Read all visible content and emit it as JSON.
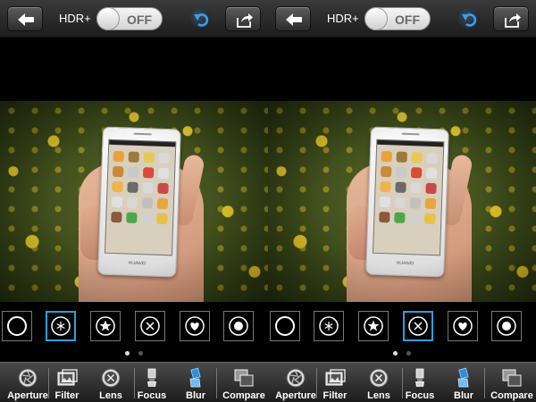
{
  "panels": [
    {
      "id": "left",
      "topbar": {
        "hdr_label": "HDR+",
        "hdr_toggle": "OFF"
      },
      "selected_shape_index": 1,
      "pager": {
        "page_count": 2,
        "active_page": 0
      },
      "toolbar": [
        "Aperture",
        "Filter",
        "Lens",
        "Focus",
        "Blur",
        "Compare"
      ]
    },
    {
      "id": "right",
      "topbar": {
        "hdr_label": "HDR+",
        "hdr_toggle": "OFF"
      },
      "selected_shape_index": 3,
      "pager": {
        "page_count": 2,
        "active_page": 0
      },
      "toolbar": [
        "Aperture",
        "Filter",
        "Lens",
        "Focus",
        "Blur",
        "Compare"
      ]
    }
  ],
  "phone_brand": "HUAWEI",
  "shapes": [
    "circle-icon",
    "asterisk-icon",
    "star-icon",
    "x-circle-icon",
    "heart-icon",
    "dot-circle-icon"
  ],
  "colors": {
    "selected": "#2c9fe0",
    "background": "#000000"
  }
}
